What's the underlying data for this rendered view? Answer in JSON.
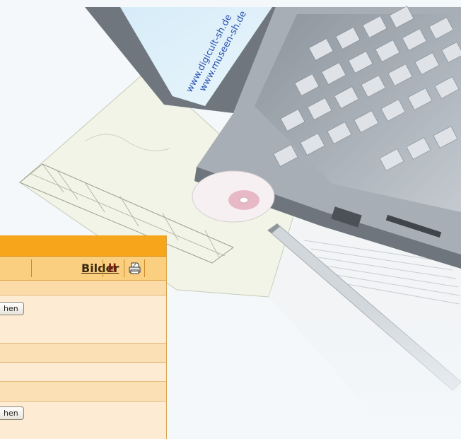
{
  "watermark": {
    "line1": "www.digicult-sh.de",
    "line2": "www.museen-sh.de"
  },
  "panel": {
    "tab_label": "Bilder",
    "help_label": "H",
    "print_icon": "printer-icon",
    "top_button_label": "hen",
    "bottom_button_label": "hen"
  },
  "colors": {
    "header_orange": "#f7a61c",
    "tab_bar": "#fbcf80",
    "panel_bg": "#fdebd3"
  }
}
